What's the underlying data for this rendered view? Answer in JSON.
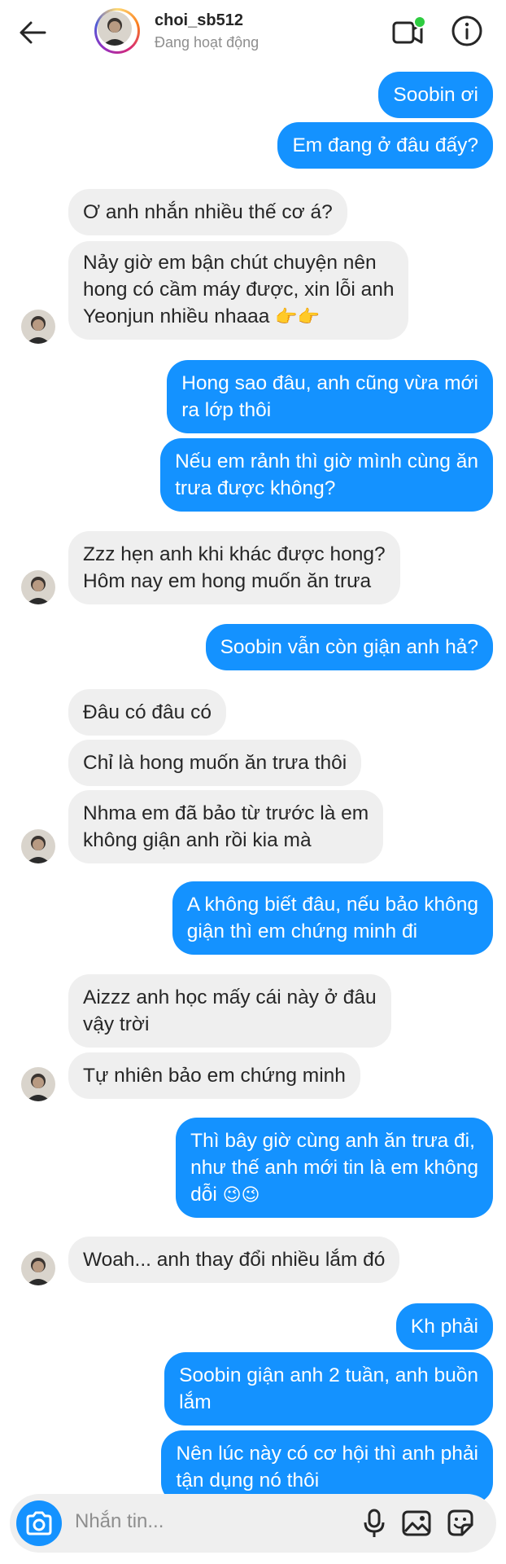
{
  "header": {
    "username": "choi_sb512",
    "status": "Đang hoạt động"
  },
  "messages": [
    {
      "side": "out",
      "text": "Soobin ơi"
    },
    {
      "side": "out",
      "text": "Em đang ở đâu đấy?"
    },
    {
      "side": "in",
      "text": "Ơ anh nhắn nhiều thế cơ á?"
    },
    {
      "side": "in",
      "lines": [
        "Nảy giờ em bận chút chuyện nên",
        "hong có cầm máy được, xin lỗi anh",
        "Yeonjun nhiều nhaaa"
      ],
      "emoji": "👉👉"
    },
    {
      "side": "out",
      "lines": [
        "Hong sao đâu, anh cũng vừa mới",
        "ra lớp thôi"
      ]
    },
    {
      "side": "out",
      "lines": [
        "Nếu em rảnh thì giờ mình cùng ăn",
        "trưa được không?"
      ]
    },
    {
      "side": "in",
      "lines": [
        "Zzz hẹn anh khi khác được hong?",
        "Hôm nay em hong muốn ăn trưa"
      ]
    },
    {
      "side": "out",
      "text": "Soobin vẫn còn giận anh hả?"
    },
    {
      "side": "in",
      "text": "Đâu có đâu có"
    },
    {
      "side": "in",
      "text": "Chỉ là hong muốn ăn trưa thôi"
    },
    {
      "side": "in",
      "lines": [
        "Nhma em đã bảo từ trước là em",
        "không giận anh rồi kia mà"
      ]
    },
    {
      "side": "out",
      "lines": [
        "A không biết đâu, nếu bảo không",
        "giận thì em chứng minh đi"
      ]
    },
    {
      "side": "in",
      "lines": [
        "Aizzz anh học mấy cái này ở đâu",
        "vậy trời"
      ]
    },
    {
      "side": "in",
      "text": "Tự nhiên bảo em chứng minh"
    },
    {
      "side": "out",
      "lines": [
        "Thì bây giờ cùng anh ăn trưa đi,",
        "như thế anh mới tin là em không",
        "dỗi"
      ],
      "emoji": "😉😉"
    },
    {
      "side": "in",
      "text": "Woah... anh thay đổi nhiều lắm đó"
    },
    {
      "side": "out",
      "text": "Kh phải"
    },
    {
      "side": "out",
      "lines": [
        "Soobin giận anh 2 tuần, anh buồn",
        "lắm"
      ]
    },
    {
      "side": "out",
      "lines": [
        "Nên lúc này có cơ hội thì anh phải",
        "tận dụng nó thôi"
      ]
    }
  ],
  "composer": {
    "placeholder": "Nhắn tin..."
  },
  "icons": {
    "back": "back-arrow-icon",
    "video": "video-call-icon",
    "info": "info-icon",
    "camera": "camera-icon",
    "mic": "microphone-icon",
    "gallery": "gallery-icon",
    "sticker": "sticker-icon"
  },
  "colors": {
    "outgoing_bubble": "#1492ff",
    "incoming_bubble": "#efefef",
    "active_dot": "#2ecc40"
  }
}
